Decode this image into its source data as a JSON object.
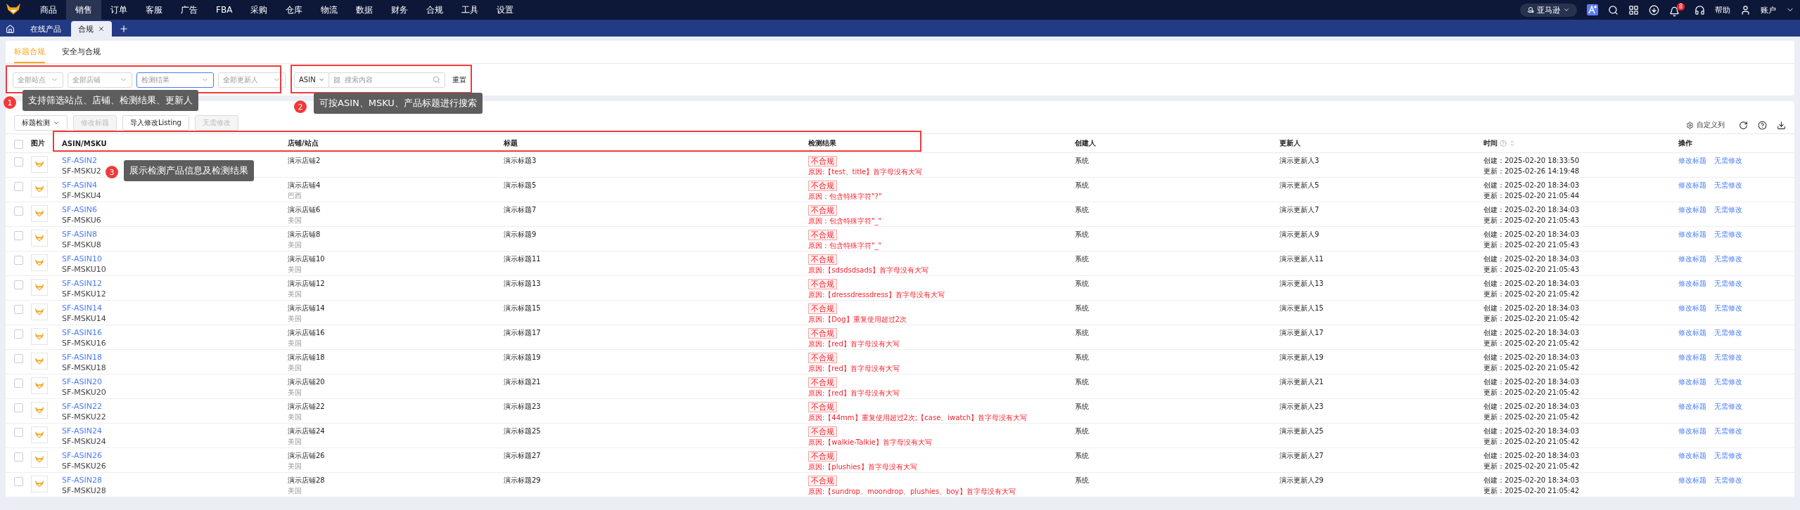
{
  "nav": {
    "menu": [
      {
        "label": "商品",
        "selected": false
      },
      {
        "label": "销售",
        "selected": true
      },
      {
        "label": "订单",
        "selected": false
      },
      {
        "label": "客服",
        "selected": false
      },
      {
        "label": "广告",
        "selected": false
      },
      {
        "label": "FBA",
        "selected": false
      },
      {
        "label": "采购",
        "selected": false
      },
      {
        "label": "仓库",
        "selected": false
      },
      {
        "label": "物流",
        "selected": false
      },
      {
        "label": "数据",
        "selected": false
      },
      {
        "label": "财务",
        "selected": false
      },
      {
        "label": "合规",
        "selected": false
      },
      {
        "label": "工具",
        "selected": false
      },
      {
        "label": "设置",
        "selected": false
      }
    ],
    "platform": "亚马逊",
    "badge": "8",
    "help": "帮助",
    "account": "账户"
  },
  "tabs": [
    {
      "label": "在线产品",
      "selected": false,
      "closable": false
    },
    {
      "label": "合规",
      "selected": true,
      "closable": true
    }
  ],
  "subtabs": [
    {
      "label": "标题合规",
      "selected": true
    },
    {
      "label": "安全与合规",
      "selected": false
    }
  ],
  "filters": [
    {
      "placeholder": "全部站点",
      "focused": false
    },
    {
      "placeholder": "全部店铺",
      "focused": false
    },
    {
      "placeholder": "检测结果",
      "focused": true
    },
    {
      "placeholder": "全部更新人",
      "focused": false
    }
  ],
  "search": {
    "type": "ASIN",
    "placeholder": "搜索内容",
    "reset": "重置"
  },
  "toolbar": {
    "buttons": [
      {
        "label": "标题检测",
        "disabled": false,
        "dropdown": true
      },
      {
        "label": "修改标题",
        "disabled": true,
        "dropdown": false
      },
      {
        "label": "导入修改Listing",
        "disabled": false,
        "dropdown": false
      },
      {
        "label": "无需修改",
        "disabled": true,
        "dropdown": false
      }
    ],
    "custom_columns": "自定义列"
  },
  "table": {
    "all_checked": false,
    "columns": [
      "图片",
      "ASIN/MSKU",
      "店铺/站点",
      "标题",
      "检测结果",
      "创建人",
      "更新人",
      "时间",
      "操作"
    ],
    "rows": [
      {
        "checked": false,
        "asin": "SF-ASIN2",
        "msku": "SF-MSKU2",
        "store": "演示店铺2",
        "title": "演示标题3",
        "status": "不合规",
        "reason": "原因:【test、title】首字母没有大写",
        "creator": "系统",
        "updater": "演示更新人3",
        "created": "创建：2025-02-20 18:33:50",
        "updated": "更新：2025-02-26 14:19:48",
        "actions": [
          "修改标题",
          "无需修改"
        ]
      },
      {
        "checked": false,
        "asin": "SF-ASIN4",
        "msku": "SF-MSKU4",
        "store": "演示店铺4",
        "site": "巴西",
        "title": "演示标题5",
        "status": "不合规",
        "reason": "原因：包含特殊字符\"?\"",
        "creator": "系统",
        "updater": "演示更新人5",
        "created": "创建：2025-02-20 18:34:03",
        "updated": "更新：2025-02-20 21:05:44",
        "actions": [
          "修改标题",
          "无需修改"
        ]
      },
      {
        "checked": false,
        "asin": "SF-ASIN6",
        "msku": "SF-MSKU6",
        "store": "演示店铺6",
        "site": "美国",
        "title": "演示标题7",
        "status": "不合规",
        "reason": "原因：包含特殊字符\"_\"",
        "creator": "系统",
        "updater": "演示更新人7",
        "created": "创建：2025-02-20 18:34:03",
        "updated": "更新：2025-02-20 21:05:43",
        "actions": [
          "修改标题",
          "无需修改"
        ]
      },
      {
        "checked": false,
        "asin": "SF-ASIN8",
        "msku": "SF-MSKU8",
        "store": "演示店铺8",
        "site": "美国",
        "title": "演示标题9",
        "status": "不合规",
        "reason": "原因：包含特殊字符\"_\"",
        "creator": "系统",
        "updater": "演示更新人9",
        "created": "创建：2025-02-20 18:34:03",
        "updated": "更新：2025-02-20 21:05:43",
        "actions": [
          "修改标题",
          "无需修改"
        ]
      },
      {
        "checked": false,
        "asin": "SF-ASIN10",
        "msku": "SF-MSKU10",
        "store": "演示店铺10",
        "site": "美国",
        "title": "演示标题11",
        "status": "不合规",
        "reason": "原因:【sdsdsdsads】首字母没有大写",
        "creator": "系统",
        "updater": "演示更新人11",
        "created": "创建：2025-02-20 18:34:03",
        "updated": "更新：2025-02-20 21:05:43",
        "actions": [
          "修改标题",
          "无需修改"
        ]
      },
      {
        "checked": false,
        "asin": "SF-ASIN12",
        "msku": "SF-MSKU12",
        "store": "演示店铺12",
        "site": "美国",
        "title": "演示标题13",
        "status": "不合规",
        "reason": "原因:【dressdressdress】首字母没有大写",
        "creator": "系统",
        "updater": "演示更新人13",
        "created": "创建：2025-02-20 18:34:03",
        "updated": "更新：2025-02-20 21:05:42",
        "actions": [
          "修改标题",
          "无需修改"
        ]
      },
      {
        "checked": false,
        "asin": "SF-ASIN14",
        "msku": "SF-MSKU14",
        "store": "演示店铺14",
        "site": "美国",
        "title": "演示标题15",
        "status": "不合规",
        "reason": "原因:【Dog】重复使用超过2次",
        "creator": "系统",
        "updater": "演示更新人15",
        "created": "创建：2025-02-20 18:34:03",
        "updated": "更新：2025-02-20 21:05:42",
        "actions": [
          "修改标题",
          "无需修改"
        ]
      },
      {
        "checked": false,
        "asin": "SF-ASIN16",
        "msku": "SF-MSKU16",
        "store": "演示店铺16",
        "site": "美国",
        "title": "演示标题17",
        "status": "不合规",
        "reason": "原因:【red】首字母没有大写",
        "creator": "系统",
        "updater": "演示更新人17",
        "created": "创建：2025-02-20 18:34:03",
        "updated": "更新：2025-02-20 21:05:42",
        "actions": [
          "修改标题",
          "无需修改"
        ]
      },
      {
        "checked": false,
        "asin": "SF-ASIN18",
        "msku": "SF-MSKU18",
        "store": "演示店铺18",
        "site": "美国",
        "title": "演示标题19",
        "status": "不合规",
        "reason": "原因:【red】首字母没有大写",
        "creator": "系统",
        "updater": "演示更新人19",
        "created": "创建：2025-02-20 18:34:03",
        "updated": "更新：2025-02-20 21:05:42",
        "actions": [
          "修改标题",
          "无需修改"
        ]
      },
      {
        "checked": false,
        "asin": "SF-ASIN20",
        "msku": "SF-MSKU20",
        "store": "演示店铺20",
        "site": "美国",
        "title": "演示标题21",
        "status": "不合规",
        "reason": "原因:【red】首字母没有大写",
        "creator": "系统",
        "updater": "演示更新人21",
        "created": "创建：2025-02-20 18:34:03",
        "updated": "更新：2025-02-20 21:05:42",
        "actions": [
          "修改标题",
          "无需修改"
        ]
      },
      {
        "checked": false,
        "asin": "SF-ASIN22",
        "msku": "SF-MSKU22",
        "store": "演示店铺22",
        "site": "美国",
        "title": "演示标题23",
        "status": "不合规",
        "reason": "原因:【44mm】重复使用超过2次;【case、iwatch】首字母没有大写",
        "creator": "系统",
        "updater": "演示更新人23",
        "created": "创建：2025-02-20 18:34:03",
        "updated": "更新：2025-02-20 21:05:42",
        "actions": [
          "修改标题",
          "无需修改"
        ]
      },
      {
        "checked": false,
        "asin": "SF-ASIN24",
        "msku": "SF-MSKU24",
        "store": "演示店铺24",
        "site": "美国",
        "title": "演示标题25",
        "status": "不合规",
        "reason": "原因:【walkie-Talkie】首字母没有大写",
        "creator": "系统",
        "updater": "演示更新人25",
        "created": "创建：2025-02-20 18:34:03",
        "updated": "更新：2025-02-20 21:05:42",
        "actions": [
          "修改标题",
          "无需修改"
        ]
      },
      {
        "checked": false,
        "asin": "SF-ASIN26",
        "msku": "SF-MSKU26",
        "store": "演示店铺26",
        "site": "美国",
        "title": "演示标题27",
        "status": "不合规",
        "reason": "原因:【plushies】首字母没有大写",
        "creator": "系统",
        "updater": "演示更新人27",
        "created": "创建：2025-02-20 18:34:03",
        "updated": "更新：2025-02-20 21:05:42",
        "actions": [
          "修改标题",
          "无需修改"
        ]
      },
      {
        "checked": false,
        "asin": "SF-ASIN28",
        "msku": "SF-MSKU28",
        "store": "演示店铺28",
        "site": "美国",
        "title": "演示标题29",
        "status": "不合规",
        "reason": "原因:【sundrop、moondrop、plushies、boy】首字母没有大写",
        "creator": "系统",
        "updater": "演示更新人29",
        "created": "创建：2025-02-20 18:34:03",
        "updated": "更新：2025-02-20 21:05:42",
        "actions": [
          "修改标题",
          "无需修改"
        ]
      }
    ]
  },
  "annotations": [
    {
      "number": "1",
      "text": "支持筛选站点、店铺、检测结果、更新人"
    },
    {
      "number": "2",
      "text": "可按ASIN、MSKU、产品标题进行搜索"
    },
    {
      "number": "3",
      "text": "展示检测产品信息及检测结果"
    }
  ]
}
